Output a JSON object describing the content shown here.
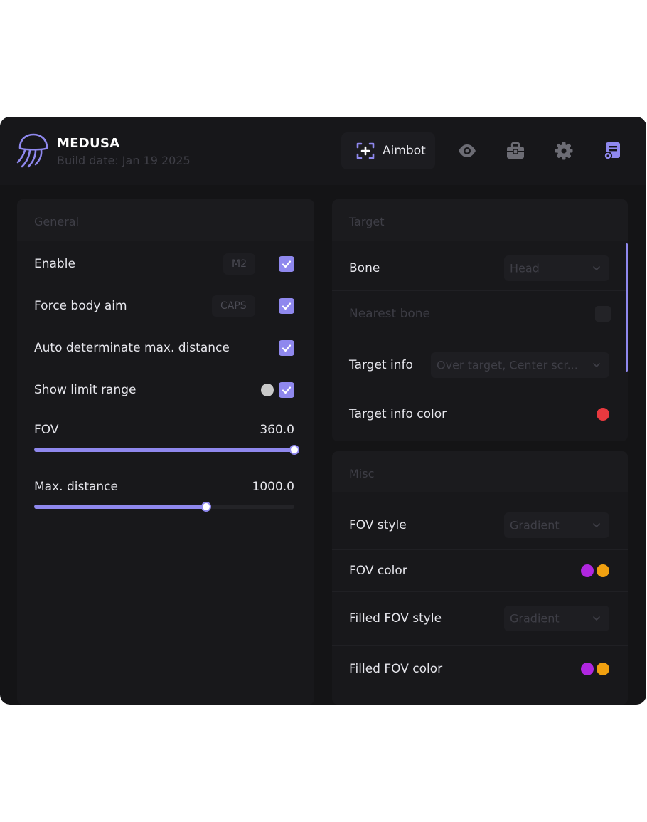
{
  "app": {
    "title": "MEDUSA",
    "build_date": "Build date: Jan 19 2025",
    "accent": "#8f88ee"
  },
  "nav": {
    "active_tab": "Aimbot",
    "icons": [
      "crosshair-plus-icon",
      "eye-icon",
      "toolbox-icon",
      "gear-icon",
      "config-list-icon"
    ]
  },
  "general": {
    "title": "General",
    "enable": {
      "label": "Enable",
      "key": "M2",
      "checked": true
    },
    "force_body_aim": {
      "label": "Force body aim",
      "key": "CAPS",
      "checked": true
    },
    "auto_max_distance": {
      "label": "Auto determinate max. distance",
      "checked": true
    },
    "show_limit_range": {
      "label": "Show limit range",
      "color": "#c8c8c8",
      "checked": true
    },
    "fov": {
      "label": "FOV",
      "value": "360.0",
      "fraction": 1.0
    },
    "max_distance": {
      "label": "Max. distance",
      "value": "1000.0",
      "fraction": 0.66
    }
  },
  "target": {
    "title": "Target",
    "bone": {
      "label": "Bone",
      "selected": "Head"
    },
    "nearest_bone": {
      "label": "Nearest bone",
      "checked": false
    },
    "target_info": {
      "label": "Target info",
      "selected": "Over target, Center scr..."
    },
    "target_info_color": {
      "label": "Target info color",
      "color": "#e8393f"
    }
  },
  "misc": {
    "title": "Misc",
    "fov_style": {
      "label": "FOV style",
      "selected": "Gradient"
    },
    "fov_color": {
      "label": "FOV color",
      "color_a": "#b026e0",
      "color_b": "#f0a010"
    },
    "filled_fov_style": {
      "label": "Filled FOV style",
      "selected": "Gradient"
    },
    "filled_fov_color": {
      "label": "Filled FOV color",
      "color_a": "#b026e0",
      "color_b": "#f0a010"
    }
  }
}
